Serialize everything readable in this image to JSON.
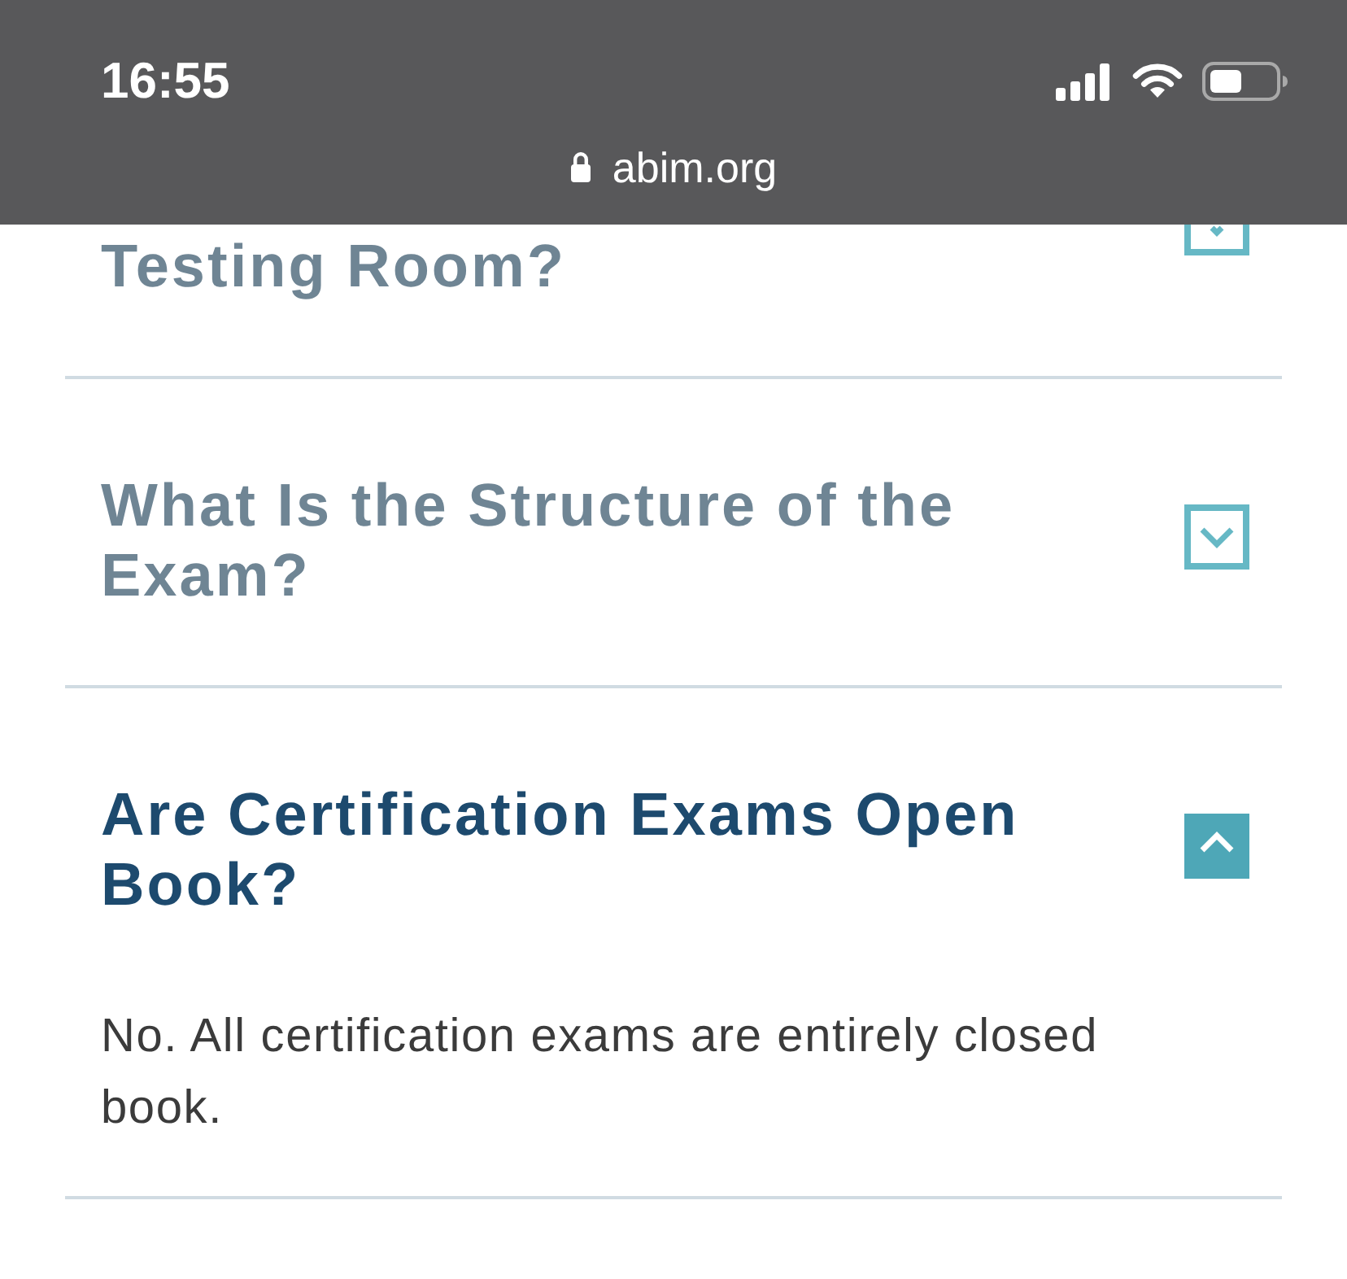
{
  "status_bar": {
    "time": "16:55"
  },
  "address_bar": {
    "url": "abim.org"
  },
  "partial_item": {
    "question": "Testing Room?",
    "expanded": false
  },
  "faq_items": [
    {
      "question": "What Is the Structure of the Exam?",
      "expanded": false
    },
    {
      "question": "Are Certification Exams Open Book?",
      "expanded": true,
      "answer": "No. All certification exams are entirely closed book."
    }
  ]
}
